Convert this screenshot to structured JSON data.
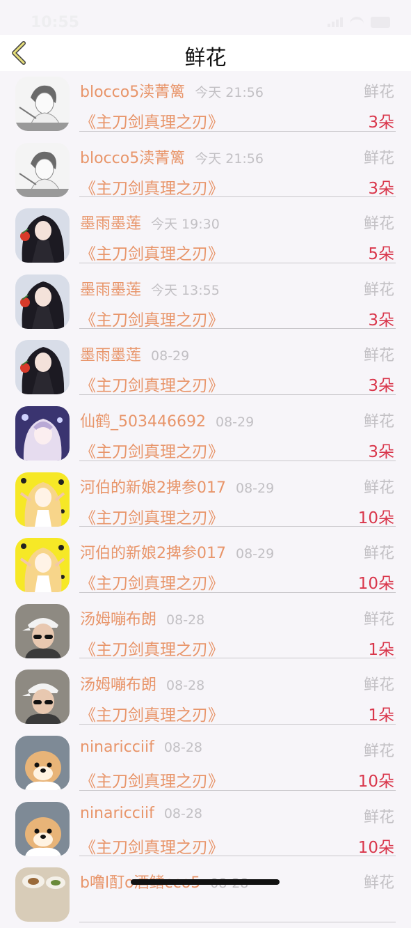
{
  "status_bar": {
    "time": "10:55"
  },
  "nav": {
    "title": "鲜花"
  },
  "colors": {
    "name": "#e8956a",
    "count": "#d9364b",
    "muted": "#c2c0c4"
  },
  "rows": [
    {
      "avatar": "sketch-avatar",
      "name": "blocco5渎菁篱",
      "time": "今天 21:56",
      "type": "鲜花",
      "book": "《主刀剑真理之刃》",
      "count": "3朵"
    },
    {
      "avatar": "sketch-avatar",
      "name": "blocco5渎菁篱",
      "time": "今天 21:56",
      "type": "鲜花",
      "book": "《主刀剑真理之刃》",
      "count": "3朵"
    },
    {
      "avatar": "anime-dark-avatar",
      "name": "墨雨墨莲",
      "time": "今天 19:30",
      "type": "鲜花",
      "book": "《主刀剑真理之刃》",
      "count": "5朵"
    },
    {
      "avatar": "anime-dark-avatar",
      "name": "墨雨墨莲",
      "time": "今天 13:55",
      "type": "鲜花",
      "book": "《主刀剑真理之刃》",
      "count": "3朵"
    },
    {
      "avatar": "anime-dark-avatar",
      "name": "墨雨墨莲",
      "time": "08-29",
      "type": "鲜花",
      "book": "《主刀剑真理之刃》",
      "count": "3朵"
    },
    {
      "avatar": "anime-purple-avatar",
      "name": "仙鹤_503446692",
      "time": "08-29",
      "type": "鲜花",
      "book": "《主刀剑真理之刃》",
      "count": "3朵"
    },
    {
      "avatar": "anime-yellow-avatar",
      "name": "河伯的新娘2捭参017",
      "time": "08-29",
      "type": "鲜花",
      "book": "《主刀剑真理之刃》",
      "count": "10朵"
    },
    {
      "avatar": "anime-yellow-avatar",
      "name": "河伯的新娘2捭参017",
      "time": "08-29",
      "type": "鲜花",
      "book": "《主刀剑真理之刃》",
      "count": "10朵"
    },
    {
      "avatar": "photo-cap-avatar",
      "name": "汤姆嘣布朗",
      "time": "08-28",
      "type": "鲜花",
      "book": "《主刀剑真理之刃》",
      "count": "1朵"
    },
    {
      "avatar": "photo-cap-avatar",
      "name": "汤姆嘣布朗",
      "time": "08-28",
      "type": "鲜花",
      "book": "《主刀剑真理之刃》",
      "count": "1朵"
    },
    {
      "avatar": "dog-avatar",
      "name": "ninaricciif",
      "time": "08-28",
      "type": "鲜花",
      "book": "《主刀剑真理之刃》",
      "count": "10朵"
    },
    {
      "avatar": "dog-avatar",
      "name": "ninaricciif",
      "time": "08-28",
      "type": "鲜花",
      "book": "《主刀剑真理之刃》",
      "count": "10朵"
    },
    {
      "avatar": "food-avatar",
      "name": "b噜l酊o酒鳍cco5",
      "time": "08-28",
      "type": "鲜花",
      "book": "",
      "count": ""
    }
  ]
}
